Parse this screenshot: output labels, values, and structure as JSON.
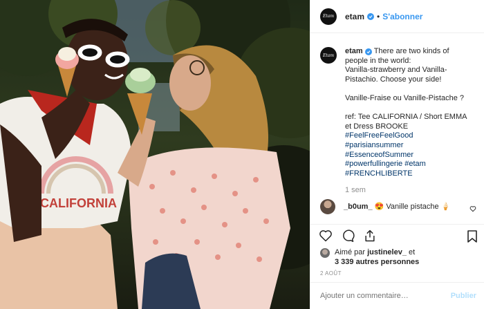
{
  "post": {
    "username": "etam",
    "avatar_text": "Etam",
    "follow_label": "S'abonner",
    "separator": "•",
    "caption_lines": [
      "There are two kinds of",
      "people in the world:",
      "Vanilla-strawberry and Vanilla-",
      "Pistachio. Choose your side!"
    ],
    "caption_french": "Vanille-Fraise ou Vanille-Pistache ?",
    "ref_lines": [
      "ref: Tee CALIFORNIA / Short EMMA",
      "et Dress BROOKE"
    ],
    "hashtags": [
      "#FeelFreeFeelGood",
      "#parisiansummer",
      "#EssenceofSummer",
      "#powerfullingerie #etam",
      "#FRENCHLIBERTE"
    ],
    "time_ago": "1 sem"
  },
  "comment": {
    "username": "_b0um_",
    "emoji": "😍",
    "text": "Vanille pistache 🍦"
  },
  "likes": {
    "prefix": "Aimé par",
    "user": "justinelev_",
    "conj": "et",
    "others": "3 339 autres personnes"
  },
  "date": "2 AOÛT",
  "add_comment": {
    "placeholder": "Ajouter un commentaire…",
    "publish_label": "Publier"
  },
  "photo": {
    "tee_text": "CALIFORNIA"
  },
  "colors": {
    "accent": "#3897f0",
    "publish_disabled": "#b2dffc",
    "muted": "#8e8e8e"
  }
}
